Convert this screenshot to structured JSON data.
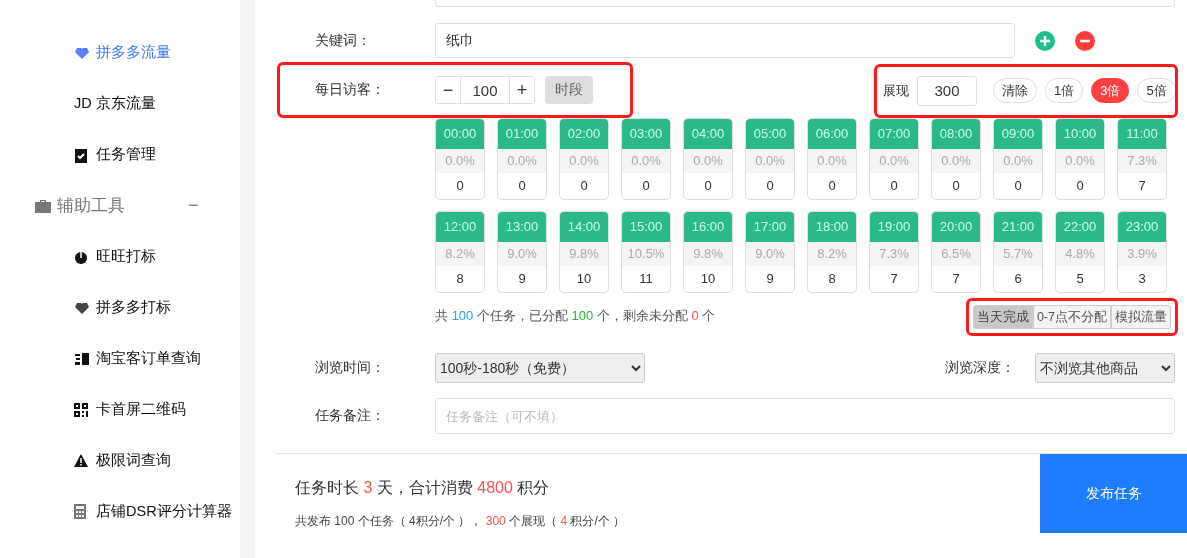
{
  "sidebar": {
    "items": [
      {
        "label": "拼多多流量",
        "selected": true
      },
      {
        "label": "JD 京东流量",
        "selected": false
      },
      {
        "label": "任务管理",
        "selected": false
      }
    ],
    "group": {
      "label": "辅助工具",
      "toggle": "−",
      "expanded": true,
      "children": [
        {
          "label": "旺旺打标",
          "selected": false
        },
        {
          "label": "拼多多打标",
          "selected": false
        },
        {
          "label": "淘宝客订单查询",
          "selected": false
        },
        {
          "label": "卡首屏二维码",
          "selected": false
        },
        {
          "label": "极限词查询",
          "selected": false
        },
        {
          "label": "店铺DSR评分计算器",
          "selected": false
        }
      ]
    }
  },
  "keyword": {
    "label": "关键词：",
    "value": "纸巾"
  },
  "visitors": {
    "label": "每日访客：",
    "minus": "−",
    "value": "100",
    "plus": "+",
    "period_button": "时段",
    "highlighted": true
  },
  "impressions": {
    "label": "展现",
    "value": "300",
    "highlighted": true,
    "buttons": [
      {
        "label": "清除",
        "selected": false
      },
      {
        "label": "1倍",
        "selected": false
      },
      {
        "label": "3倍",
        "selected": true
      },
      {
        "label": "5倍",
        "selected": false
      }
    ]
  },
  "hours": [
    {
      "time": "00:00",
      "share": "0.0%",
      "count": "0"
    },
    {
      "time": "01:00",
      "share": "0.0%",
      "count": "0"
    },
    {
      "time": "02:00",
      "share": "0.0%",
      "count": "0"
    },
    {
      "time": "03:00",
      "share": "0.0%",
      "count": "0"
    },
    {
      "time": "04:00",
      "share": "0.0%",
      "count": "0"
    },
    {
      "time": "05:00",
      "share": "0.0%",
      "count": "0"
    },
    {
      "time": "06:00",
      "share": "0.0%",
      "count": "0"
    },
    {
      "time": "07:00",
      "share": "0.0%",
      "count": "0"
    },
    {
      "time": "08:00",
      "share": "0.0%",
      "count": "0"
    },
    {
      "time": "09:00",
      "share": "0.0%",
      "count": "0"
    },
    {
      "time": "10:00",
      "share": "0.0%",
      "count": "0"
    },
    {
      "time": "11:00",
      "share": "7.3%",
      "count": "7"
    },
    {
      "time": "12:00",
      "share": "8.2%",
      "count": "8"
    },
    {
      "time": "13:00",
      "share": "9.0%",
      "count": "9"
    },
    {
      "time": "14:00",
      "share": "9.8%",
      "count": "10"
    },
    {
      "time": "15:00",
      "share": "10.5%",
      "count": "11"
    },
    {
      "time": "16:00",
      "share": "9.8%",
      "count": "10"
    },
    {
      "time": "17:00",
      "share": "9.0%",
      "count": "9"
    },
    {
      "time": "18:00",
      "share": "8.2%",
      "count": "8"
    },
    {
      "time": "19:00",
      "share": "7.3%",
      "count": "7"
    },
    {
      "time": "20:00",
      "share": "6.5%",
      "count": "7"
    },
    {
      "time": "21:00",
      "share": "5.7%",
      "count": "6"
    },
    {
      "time": "22:00",
      "share": "4.8%",
      "count": "5"
    },
    {
      "time": "23:00",
      "share": "3.9%",
      "count": "3"
    }
  ],
  "summary": [
    {
      "text": "共 ",
      "color": "#555555"
    },
    {
      "text": "100",
      "color": "#1e9fff"
    },
    {
      "text": " 个任务，已分配 ",
      "color": "#555555"
    },
    {
      "text": "100",
      "color": "#2bb52b"
    },
    {
      "text": " 个，剩余未分配 ",
      "color": "#555555"
    },
    {
      "text": "0",
      "color": "#ff5050"
    },
    {
      "text": " 个",
      "color": "#555555"
    }
  ],
  "modes": {
    "highlighted": true,
    "options": [
      {
        "label": "当天完成",
        "selected": true
      },
      {
        "label": "0-7点不分配",
        "selected": false
      },
      {
        "label": "模拟流量",
        "selected": false
      }
    ]
  },
  "browse_time": {
    "label": "浏览时间：",
    "value": "100秒-180秒（免费）"
  },
  "browse_depth": {
    "label": "浏览深度：",
    "value": "不浏览其他商品"
  },
  "remark": {
    "label": "任务备注：",
    "placeholder": "任务备注（可不填）"
  },
  "footer": {
    "duration": [
      {
        "text": "任务时长 ",
        "color": "#333333"
      },
      {
        "text": "3",
        "color": "#ff5050"
      },
      {
        "text": " 天，合计消费 ",
        "color": "#333333"
      },
      {
        "text": "4800",
        "color": "#ff5050"
      },
      {
        "text": " 积分",
        "color": "#333333"
      }
    ],
    "detail": [
      {
        "text": "共发布 100 个任务（ 4积分/个 ）， "
      },
      {
        "text": "300",
        "color": "#ff5050"
      },
      {
        "text": " 个展现（ "
      },
      {
        "text": "4",
        "color": "#ff5050"
      },
      {
        "text": " 积分/个 ）"
      }
    ],
    "publish_button": "发布任务"
  }
}
